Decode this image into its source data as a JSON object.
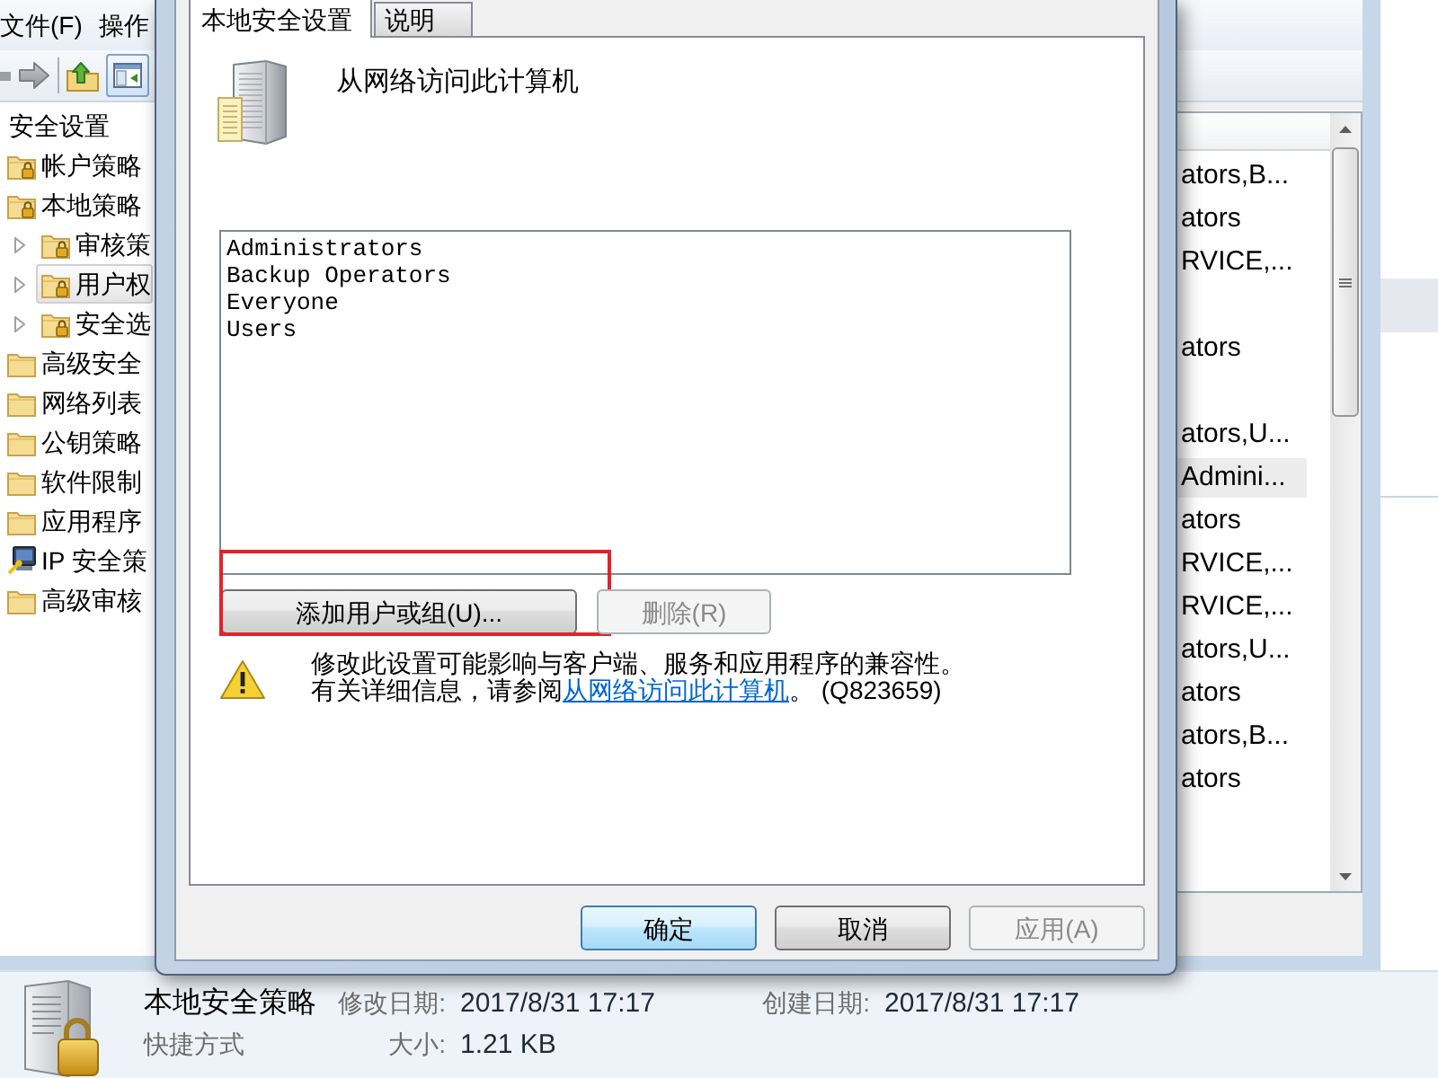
{
  "menu": [
    "文件(F)",
    "操作"
  ],
  "toolbar": [
    {
      "kind": "back",
      "pressed": false
    },
    {
      "kind": "forward",
      "pressed": false
    },
    {
      "kind": "separator"
    },
    {
      "kind": "up",
      "pressed": false
    },
    {
      "kind": "tree_toggle",
      "pressed": true
    }
  ],
  "tree": [
    {
      "label": "安全设置",
      "selected": false,
      "children": [
        {
          "label": "帐户策略",
          "kind": "locked_folder",
          "selected": false
        },
        {
          "label": "本地策略",
          "kind": "locked_folder",
          "selected": false,
          "children": [
            {
              "label": "审核策",
              "kind": "locked_folder",
              "selected": false,
              "expanded": false
            },
            {
              "label": "用户权",
              "kind": "locked_folder",
              "selected": true,
              "expanded": false
            },
            {
              "label": "安全选",
              "kind": "locked_folder",
              "selected": false,
              "expanded": false
            }
          ]
        },
        {
          "label": "高级安全",
          "kind": "folder",
          "selected": false
        },
        {
          "label": "网络列表",
          "kind": "folder",
          "selected": false
        },
        {
          "label": "公钥策略",
          "kind": "folder",
          "selected": false
        },
        {
          "label": "软件限制",
          "kind": "folder",
          "selected": false
        },
        {
          "label": "应用程序",
          "kind": "folder",
          "selected": false
        },
        {
          "label": "IP 安全策",
          "kind": "ip_policy",
          "selected": false
        },
        {
          "label": "高级审核",
          "kind": "folder",
          "selected": false
        }
      ]
    }
  ],
  "list_rows": [
    {
      "text": "ators,B...",
      "selected": false
    },
    {
      "text": "ators",
      "selected": false
    },
    {
      "text": "RVICE,...",
      "selected": false
    },
    {
      "selected": false
    },
    {
      "text": "ators",
      "selected": false
    },
    {
      "selected": false
    },
    {
      "text": "ators,U...",
      "selected": false
    },
    {
      "text": "Admini...",
      "selected": true
    },
    {
      "text": "ators",
      "selected": false
    },
    {
      "text": "RVICE,...",
      "selected": false
    },
    {
      "text": "RVICE,...",
      "selected": false
    },
    {
      "text": "ators,U...",
      "selected": false
    },
    {
      "text": "ators",
      "selected": false
    },
    {
      "text": "ators,B...",
      "selected": false
    },
    {
      "text": "ators",
      "selected": false
    }
  ],
  "dialog": {
    "tabs": [
      {
        "label": "本地安全设置",
        "selected": true
      },
      {
        "label": "说明",
        "selected": false
      }
    ],
    "policy_title": "从网络访问此计算机",
    "members": [
      {
        "name": "Administrators",
        "selected": false
      },
      {
        "name": "Backup Operators",
        "selected": false
      },
      {
        "name": "Everyone",
        "selected": false
      },
      {
        "name": "Users",
        "selected": false
      }
    ],
    "member_buttons": [
      {
        "label": "添加用户或组(U)...",
        "disabled": false,
        "highlighted": true
      },
      {
        "label": "删除(R)",
        "disabled": true,
        "highlighted": false
      }
    ],
    "warning": {
      "text": "修改此设置可能影响与客户端、服务和应用程序的兼容性。",
      "help_prefix": "有关详细信息，请参阅",
      "help_link": "从网络访问此计算机",
      "help_suffix": "。 (Q823659)"
    },
    "buttons": [
      {
        "label": "确定",
        "default": true,
        "disabled": false
      },
      {
        "label": "取消",
        "default": false,
        "disabled": false
      },
      {
        "label": "应用(A)",
        "default": false,
        "disabled": true
      }
    ]
  },
  "details_pane": {
    "name": "本地安全策略",
    "type": "快捷方式",
    "properties": [
      {
        "label": "修改日期:",
        "value": "2017/8/31 17:17"
      },
      {
        "label": "创建日期:",
        "value": "2017/8/31 17:17"
      },
      {
        "label": "大小:",
        "value": "1.21 KB"
      }
    ]
  }
}
